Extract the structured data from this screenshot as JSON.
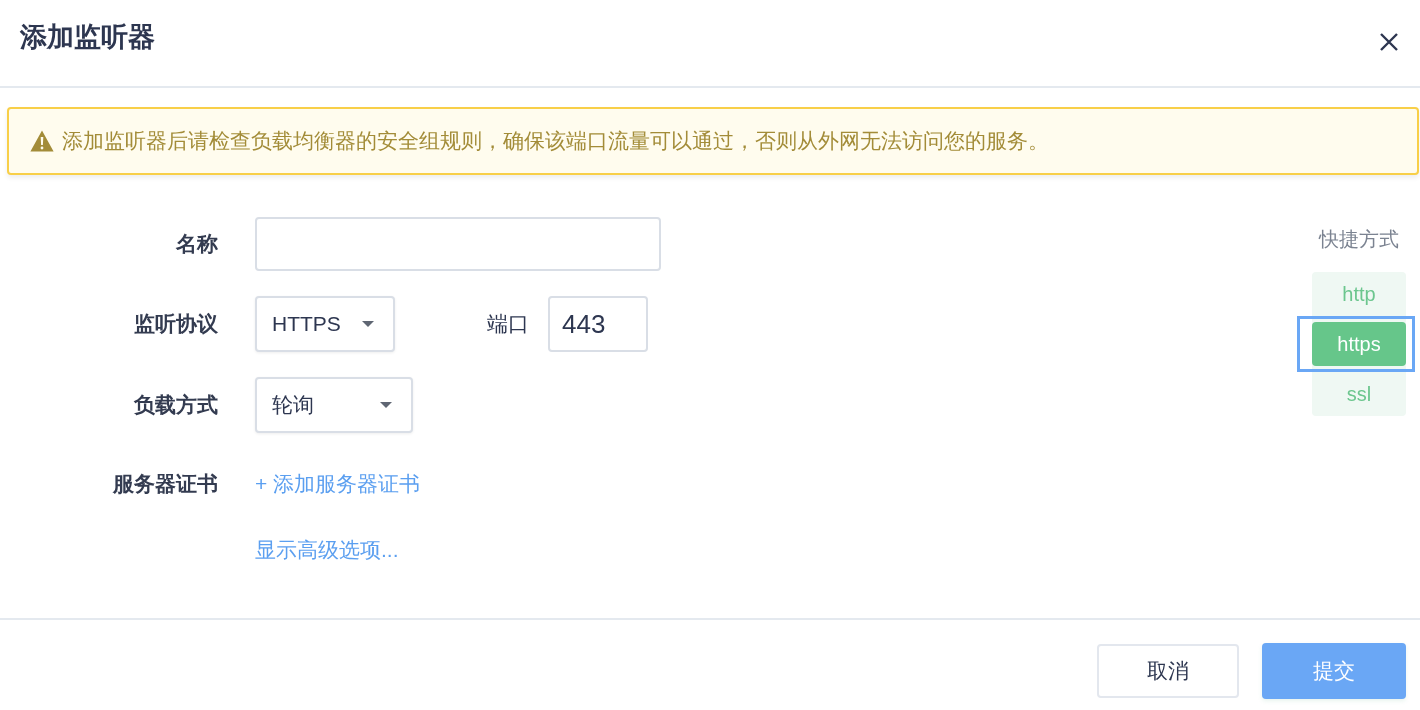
{
  "header": {
    "title": "添加监听器"
  },
  "alert": {
    "kind": "warning",
    "text": "添加监听器后请检查负载均衡器的安全组规则，确保该端口流量可以通过，否则从外网无法访问您的服务。"
  },
  "form": {
    "rows": [
      {
        "kind": "text",
        "label": "名称"
      },
      {
        "kind": "select",
        "label": "监听协议",
        "value": "HTTPS",
        "port": {
          "label": "端口",
          "value": "443"
        }
      },
      {
        "kind": "select",
        "label": "负载方式",
        "value": "轮询"
      },
      {
        "kind": "link",
        "label": "服务器证书",
        "link": "+ 添加服务器证书"
      },
      {
        "kind": "link",
        "link": "显示高级选项..."
      }
    ]
  },
  "shortcuts": {
    "title": "快捷方式",
    "items": [
      {
        "label": "http",
        "selected": false
      },
      {
        "label": "https",
        "selected": true
      },
      {
        "label": "ssl",
        "selected": false
      }
    ]
  },
  "footer": {
    "buttons": [
      {
        "kind": "secondary",
        "label": "取消"
      },
      {
        "kind": "primary",
        "label": "提交"
      }
    ]
  }
}
